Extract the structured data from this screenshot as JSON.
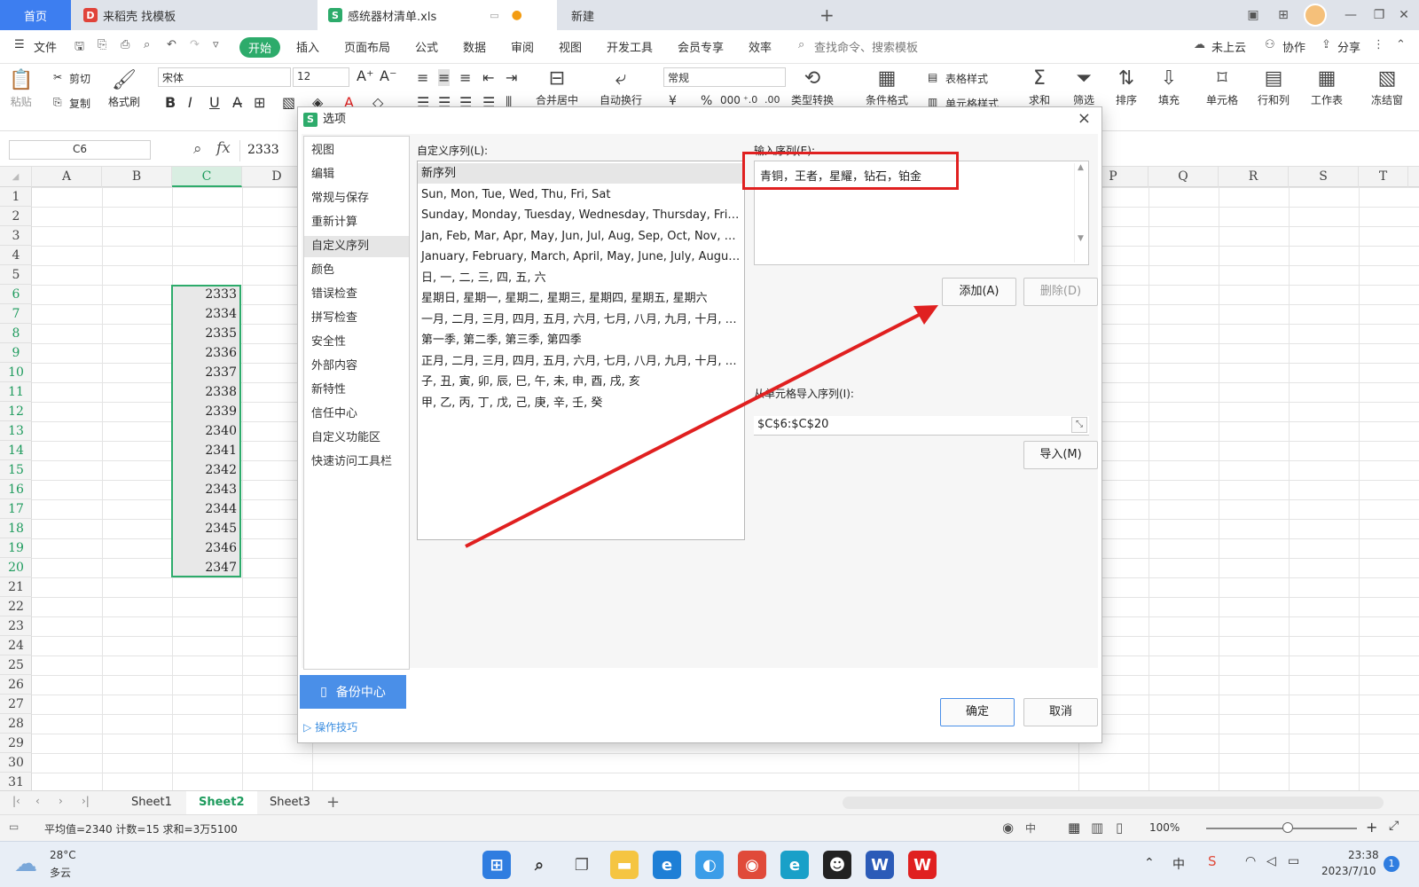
{
  "tabs": {
    "home": "首页",
    "template": "来稻壳 找模板",
    "file": "感统器材清单.xls",
    "new": "新建",
    "plus": "+"
  },
  "menu": {
    "file": "文件",
    "start": "开始",
    "items": [
      "插入",
      "页面布局",
      "公式",
      "数据",
      "审阅",
      "视图",
      "开发工具",
      "会员专享",
      "效率"
    ],
    "search": "查找命令、搜索模板",
    "cloud": "未上云",
    "collab": "协作",
    "share": "分享"
  },
  "ribbon": {
    "cut": "剪切",
    "paste": "粘贴",
    "copy": "复制",
    "format_painter": "格式刷",
    "font": "宋体",
    "size": "12",
    "bold": "B",
    "italic": "I",
    "underline": "U",
    "number_format": "常规",
    "merge": "合并居中",
    "wrap": "自动换行",
    "type_convert": "类型转换",
    "cond_format": "条件格式",
    "table_style": "表格样式",
    "cell_style": "单元格样式",
    "sum": "求和",
    "filter": "筛选",
    "sort": "排序",
    "fill": "填充",
    "cell": "单元格",
    "rowcol": "行和列",
    "sheet": "工作表",
    "freeze": "冻结窗"
  },
  "formula": {
    "namebox": "C6",
    "fx": "fx",
    "value": "2333"
  },
  "grid": {
    "left_cols": [
      "A",
      "B",
      "C",
      "D"
    ],
    "right_cols": [
      "P",
      "Q",
      "R",
      "S",
      "T"
    ],
    "rows": [
      "1",
      "2",
      "3",
      "4",
      "5",
      "6",
      "7",
      "8",
      "9",
      "10",
      "11",
      "12",
      "13",
      "14",
      "15",
      "16",
      "17",
      "18",
      "19",
      "20",
      "21",
      "22",
      "23",
      "24",
      "25",
      "26",
      "27",
      "28",
      "29",
      "30",
      "31"
    ],
    "values": [
      "2333",
      "2334",
      "2335",
      "2336",
      "2337",
      "2338",
      "2339",
      "2340",
      "2341",
      "2342",
      "2343",
      "2344",
      "2345",
      "2346",
      "2347"
    ]
  },
  "sheets": [
    "Sheet1",
    "Sheet2",
    "Sheet3"
  ],
  "status": {
    "summary": "平均值=2340  计数=15  求和=3万5100",
    "zoom": "100%"
  },
  "taskbar": {
    "temp": "28°C",
    "weather": "多云",
    "ime": "中",
    "time": "23:38",
    "date": "2023/7/10",
    "notif": "1"
  },
  "dialog": {
    "title": "选项",
    "close": "×",
    "nav": [
      "视图",
      "编辑",
      "常规与保存",
      "重新计算",
      "自定义序列",
      "颜色",
      "错误检查",
      "拼写检查",
      "安全性",
      "外部内容",
      "新特性",
      "信任中心",
      "自定义功能区",
      "快速访问工具栏"
    ],
    "backup": "备份中心",
    "tips": "操作技巧",
    "list_label": "自定义序列(L):",
    "sequences": [
      "新序列",
      "Sun, Mon, Tue, Wed, Thu, Fri, Sat",
      "Sunday, Monday, Tuesday, Wednesday, Thursday, Friday,...",
      "Jan, Feb, Mar, Apr, May, Jun, Jul, Aug, Sep, Oct, Nov, Dec",
      "January, February, March, April, May, June, July, August, ...",
      "日, 一, 二, 三, 四, 五, 六",
      "星期日, 星期一, 星期二, 星期三, 星期四, 星期五, 星期六",
      "一月, 二月, 三月, 四月, 五月, 六月, 七月, 八月, 九月, 十月, 十...",
      "第一季, 第二季, 第三季, 第四季",
      "正月, 二月, 三月, 四月, 五月, 六月, 七月, 八月, 九月, 十月, 十...",
      "子, 丑, 寅, 卯, 辰, 巳, 午, 未, 申, 酉, 戌, 亥",
      "甲, 乙, 丙, 丁, 戊, 己, 庚, 辛, 壬, 癸"
    ],
    "input_label": "输入序列(E):",
    "input_value": "青铜，王者，星耀，钻石，铂金",
    "add": "添加(A)",
    "delete": "删除(D)",
    "import_label": "从单元格导入序列(I):",
    "import_value": "$C$6:$C$20",
    "import": "导入(M)",
    "ok": "确定",
    "cancel": "取消"
  },
  "colors": {
    "accent": "#2dab6b",
    "home_tab": "#3d7ef0",
    "highlight": "#e02020"
  }
}
